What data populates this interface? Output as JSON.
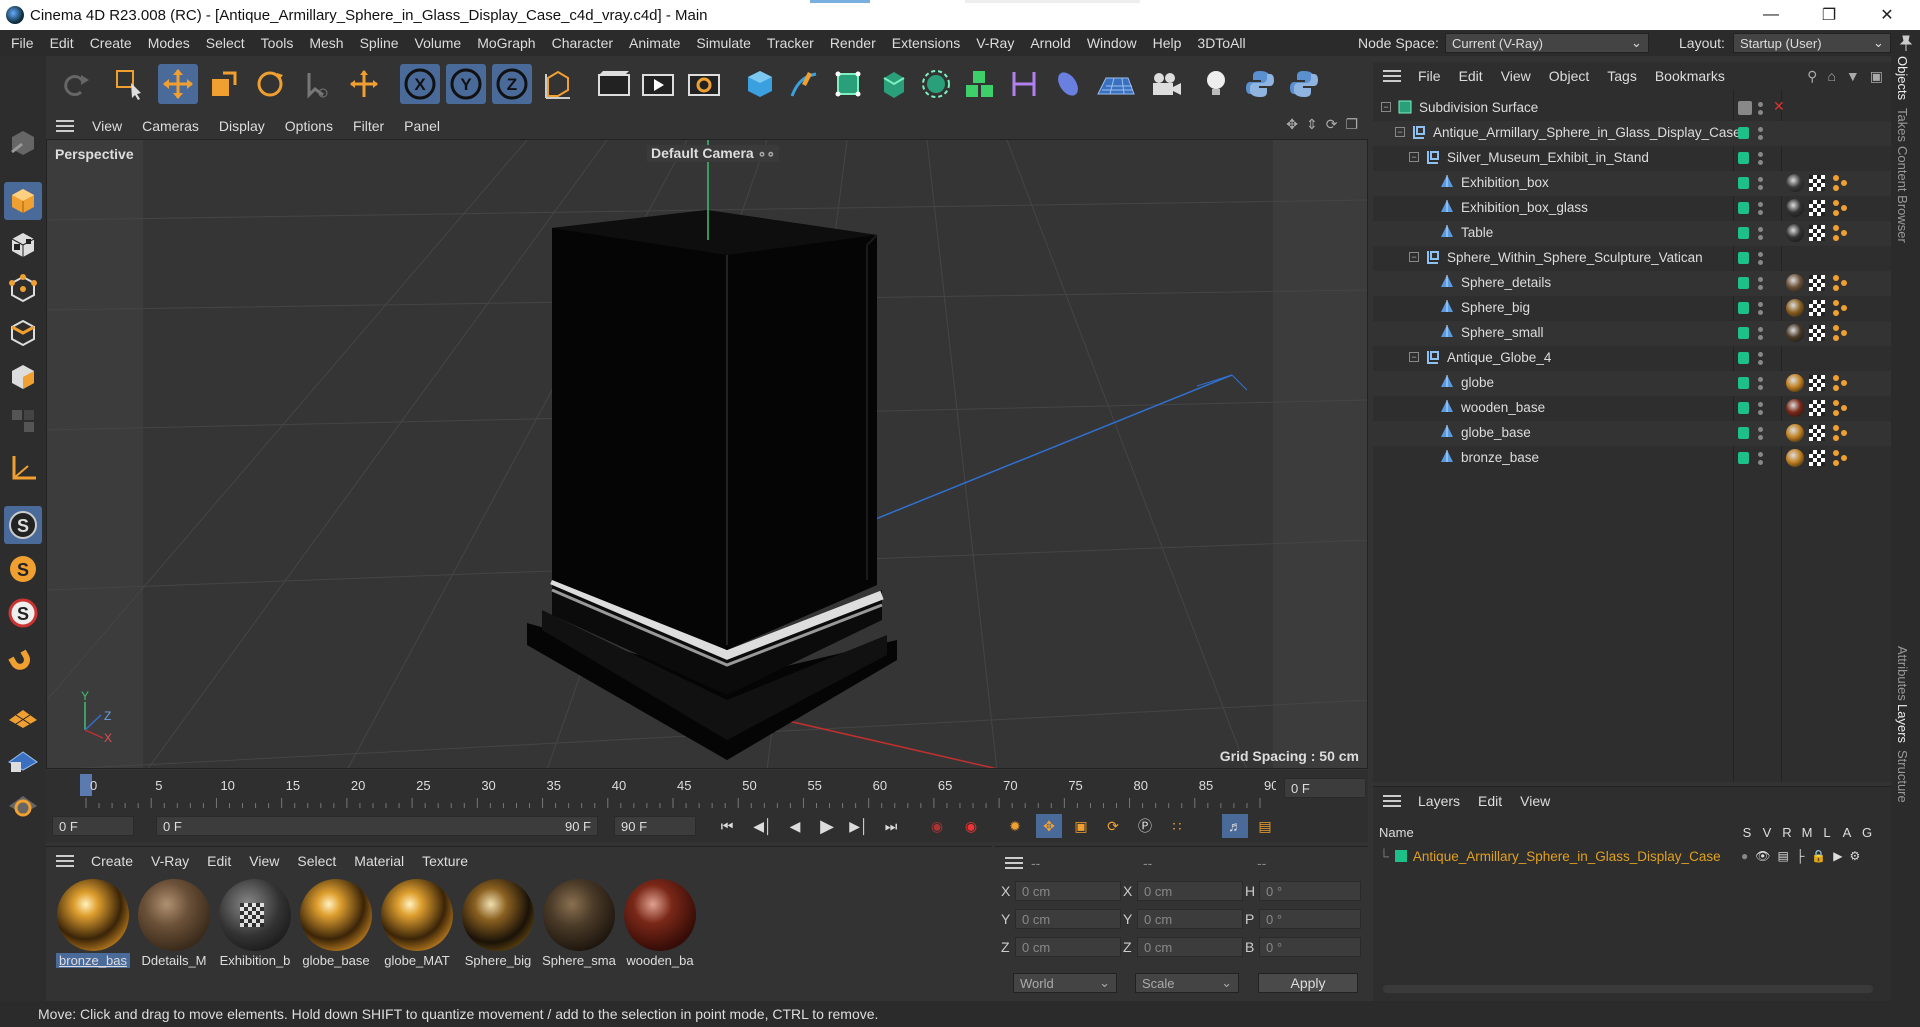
{
  "title": {
    "text": "Cinema 4D R23.008 (RC) - [Antique_Armillary_Sphere_in_Glass_Display_Case_c4d_vray.c4d] - Main"
  },
  "menubar": {
    "items": [
      "File",
      "Edit",
      "Create",
      "Modes",
      "Select",
      "Tools",
      "Mesh",
      "Spline",
      "Volume",
      "MoGraph",
      "Character",
      "Animate",
      "Simulate",
      "Tracker",
      "Render",
      "Extensions",
      "V-Ray",
      "Arnold",
      "Window",
      "Help",
      "3DToAll"
    ],
    "node_space_label": "Node Space:",
    "node_space_value": "Current (V-Ray)",
    "layout_label": "Layout:",
    "layout_value": "Startup (User)"
  },
  "viewport": {
    "menu": [
      "View",
      "Cameras",
      "Display",
      "Options",
      "Filter",
      "Panel"
    ],
    "label": "Perspective",
    "camera": "Default Camera",
    "grid_spacing": "Grid Spacing : 50 cm"
  },
  "timeline": {
    "ticks": [
      "0",
      "5",
      "10",
      "15",
      "20",
      "25",
      "30",
      "35",
      "40",
      "45",
      "50",
      "55",
      "60",
      "65",
      "70",
      "75",
      "80",
      "85",
      "90"
    ],
    "current_frame": "0 F",
    "start_field": "0 F",
    "range_start": "0 F",
    "range_end": "90 F",
    "end_field": "90 F"
  },
  "material_panel": {
    "menu": [
      "Create",
      "V-Ray",
      "Edit",
      "View",
      "Select",
      "Material",
      "Texture"
    ],
    "materials": [
      {
        "name": "bronze_bas",
        "style": "gold"
      },
      {
        "name": "Ddetails_M",
        "style": "stone"
      },
      {
        "name": "Exhibition_b",
        "style": "checker"
      },
      {
        "name": "globe_base",
        "style": "gold"
      },
      {
        "name": "globe_MAT",
        "style": "gold"
      },
      {
        "name": "Sphere_big",
        "style": "darkgold"
      },
      {
        "name": "Sphere_sma",
        "style": "darkstone"
      },
      {
        "name": "wooden_ba",
        "style": "wood"
      }
    ]
  },
  "coord_panel": {
    "headers": [
      "--",
      "--",
      "--"
    ],
    "rows": [
      {
        "a": "X",
        "av": "0 cm",
        "b": "X",
        "bv": "0 cm",
        "c": "H",
        "cv": "0 °"
      },
      {
        "a": "Y",
        "av": "0 cm",
        "b": "Y",
        "bv": "0 cm",
        "c": "P",
        "cv": "0 °"
      },
      {
        "a": "Z",
        "av": "0 cm",
        "b": "Z",
        "bv": "0 cm",
        "c": "B",
        "cv": "0 °"
      }
    ],
    "world": "World",
    "scale": "Scale",
    "apply": "Apply"
  },
  "object_panel": {
    "menu": [
      "File",
      "Edit",
      "View",
      "Object",
      "Tags",
      "Bookmarks"
    ],
    "objects": [
      {
        "name": "Subdivision Surface",
        "indent": 0,
        "kind": "subdiv",
        "tags": false
      },
      {
        "name": "Antique_Armillary_Sphere_in_Glass_Display_Case",
        "indent": 1,
        "kind": "null",
        "tags": false
      },
      {
        "name": "Silver_Museum_Exhibit_in_Stand",
        "indent": 2,
        "kind": "null",
        "tags": false
      },
      {
        "name": "Exhibition_box",
        "indent": 3,
        "kind": "poly",
        "tags": true
      },
      {
        "name": "Exhibition_box_glass",
        "indent": 3,
        "kind": "poly",
        "tags": true
      },
      {
        "name": "Table",
        "indent": 3,
        "kind": "poly",
        "tags": true
      },
      {
        "name": "Sphere_Within_Sphere_Sculpture_Vatican",
        "indent": 2,
        "kind": "null",
        "tags": false
      },
      {
        "name": "Sphere_details",
        "indent": 3,
        "kind": "poly",
        "tags": true
      },
      {
        "name": "Sphere_big",
        "indent": 3,
        "kind": "poly",
        "tags": true
      },
      {
        "name": "Sphere_small",
        "indent": 3,
        "kind": "poly",
        "tags": true
      },
      {
        "name": "Antique_Globe_4",
        "indent": 2,
        "kind": "null",
        "tags": false
      },
      {
        "name": "globe",
        "indent": 3,
        "kind": "poly",
        "tags": true
      },
      {
        "name": "wooden_base",
        "indent": 3,
        "kind": "poly",
        "tags": true
      },
      {
        "name": "globe_base",
        "indent": 3,
        "kind": "poly",
        "tags": true
      },
      {
        "name": "bronze_base",
        "indent": 3,
        "kind": "poly",
        "tags": true
      }
    ]
  },
  "layer_panel": {
    "menu": [
      "Layers",
      "Edit",
      "View"
    ],
    "columns": {
      "name": "Name",
      "flags": [
        "S",
        "V",
        "R",
        "M",
        "L",
        "A",
        "G"
      ]
    },
    "layer_name": "Antique_Armillary_Sphere_in_Glass_Display_Case"
  },
  "right_tabs": [
    "Objects",
    "Takes",
    "Content Browser",
    "Attributes",
    "Layers",
    "Structure"
  ],
  "status": "Move: Click and drag to move elements. Hold down SHIFT to quantize movement / add to the selection in point mode, CTRL to remove.",
  "colors": {
    "accent": "#1ec08a",
    "layer_text": "#e0a020",
    "selection": "#4a6a9a"
  }
}
